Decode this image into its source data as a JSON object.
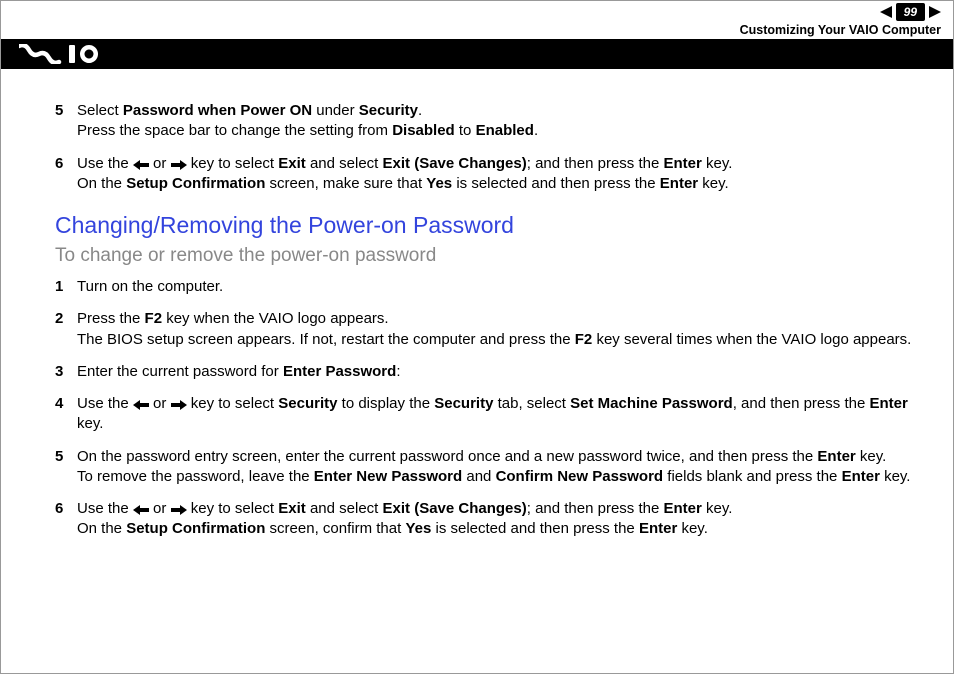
{
  "header": {
    "page_number": "99",
    "breadcrumb": "Customizing Your VAIO Computer"
  },
  "intro_steps": [
    {
      "num": "5",
      "html": "Select <b>Password when Power ON</b> under <b>Security</b>.<br>Press the space bar to change the setting from <b>Disabled</b> to <b>Enabled</b>."
    },
    {
      "num": "6",
      "html": "Use the {LARR} or {RARR} key to select <b>Exit</b> and select <b>Exit (Save Changes)</b>; and then press the <b>Enter</b> key.<br>On the <b>Setup Confirmation</b> screen, make sure that <b>Yes</b> is selected and then press the <b>Enter</b> key."
    }
  ],
  "section_title": "Changing/Removing the Power-on Password",
  "sub_title": "To change or remove the power-on password",
  "steps": [
    {
      "num": "1",
      "html": "Turn on the computer."
    },
    {
      "num": "2",
      "html": "Press the <b>F2</b> key when the VAIO logo appears.<br>The BIOS setup screen appears. If not, restart the computer and press the <b>F2</b> key several times when the VAIO logo appears."
    },
    {
      "num": "3",
      "html": "Enter the current password for <b>Enter Password</b>:"
    },
    {
      "num": "4",
      "html": "Use the {LARR} or {RARR} key to select <b>Security</b> to display the <b>Security</b> tab, select <b>Set Machine Password</b>, and then press the <b>Enter</b> key."
    },
    {
      "num": "5",
      "html": "On the password entry screen, enter the current password once and a new password twice, and then press the <b>Enter</b> key.<br>To remove the password, leave the <b>Enter New Password</b> and <b>Confirm New Password</b> fields blank and press the <b>Enter</b> key."
    },
    {
      "num": "6",
      "html": "Use the {LARR} or {RARR} key to select <b>Exit</b> and select <b>Exit (Save Changes)</b>; and then press the <b>Enter</b> key.<br>On the <b>Setup Confirmation</b> screen, confirm that <b>Yes</b> is selected and then press the <b>Enter</b> key."
    }
  ]
}
